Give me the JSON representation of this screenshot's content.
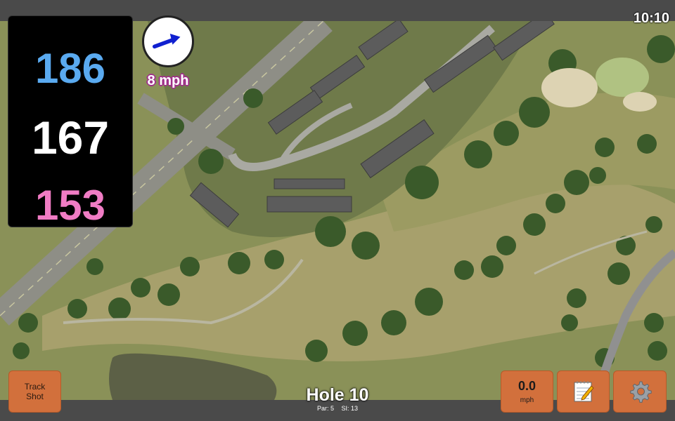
{
  "status": {
    "time": "10:10"
  },
  "distances": {
    "back": "186",
    "center": "167",
    "front": "153"
  },
  "wind": {
    "speed_label": "8 mph",
    "icon": "wind-direction-arrow-icon"
  },
  "track_button": {
    "line1": "Track",
    "line2": "Shot"
  },
  "hole": {
    "title": "Hole 10",
    "par": "Par: 5",
    "stroke_index": "SI: 13"
  },
  "speed_button": {
    "value": "0.0",
    "unit": "mph"
  },
  "notes_button": {
    "icon": "notepad-icon"
  },
  "settings_button": {
    "icon": "gear-icon"
  },
  "colors": {
    "back": "#5aaaf0",
    "center": "#ffffff",
    "front": "#f07cc4",
    "button": "#d2703c",
    "wind_outline": "#a0308a"
  }
}
